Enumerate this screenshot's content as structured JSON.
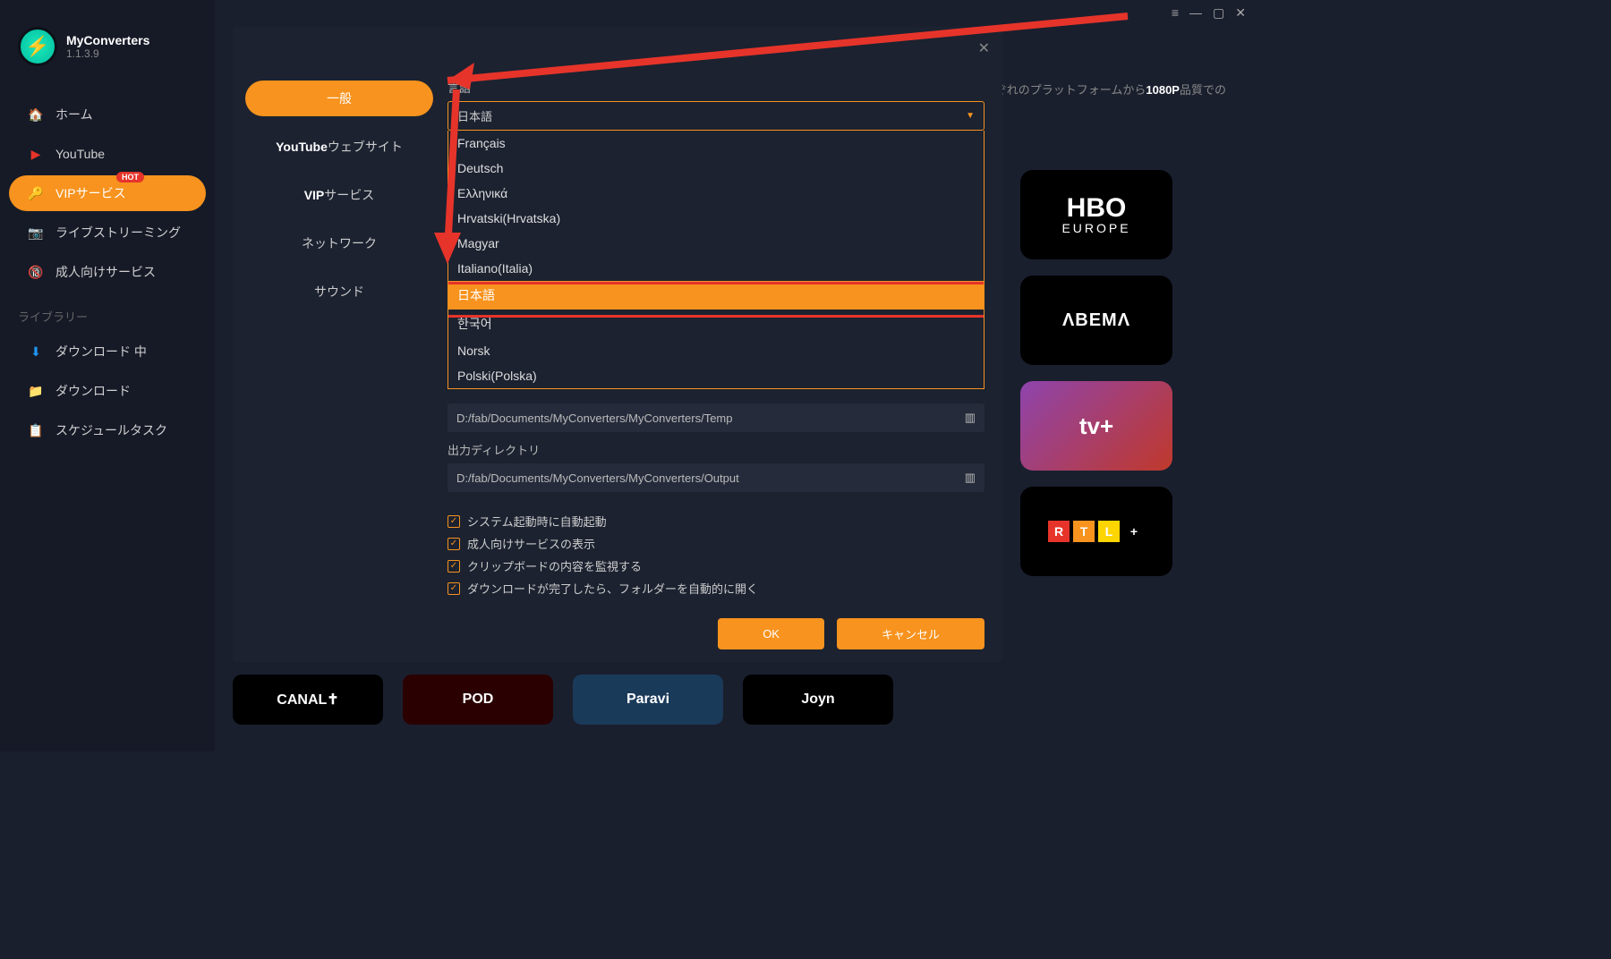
{
  "app": {
    "name": "MyConverters",
    "version": "1.1.3.9"
  },
  "titlebar": {
    "menu": "≡",
    "min": "—",
    "max": "▢",
    "close": "✕"
  },
  "sidebar": {
    "items": [
      {
        "icon": "🏠",
        "label": "ホーム"
      },
      {
        "icon": "▶",
        "label": "YouTube",
        "iconColor": "#e6342a"
      },
      {
        "icon": "🔑",
        "label": "VIPサービス",
        "hot": "HOT"
      },
      {
        "icon": "📷",
        "label": "ライブストリーミング",
        "iconColor": "#e6342a"
      },
      {
        "icon": "🔞",
        "label": "成人向けサービス",
        "iconColor": "#e6342a"
      }
    ],
    "library_label": "ライブラリー",
    "library": [
      {
        "icon": "⬇",
        "label": "ダウンロード 中",
        "iconColor": "#2196f3"
      },
      {
        "icon": "📁",
        "label": "ダウンロード",
        "iconColor": "#f7931e"
      },
      {
        "icon": "📋",
        "label": "スケジュールタスク",
        "iconColor": "#9c27b0"
      }
    ]
  },
  "bg": {
    "text_prefix": "ぞれのプラットフォームから",
    "quality": "1080P",
    "text_suffix": "品質での"
  },
  "tiles": {
    "hbo": "HBO",
    "hbo_sub": "EUROPE",
    "abema": "ΛBEMΛ",
    "appletv": "tv+",
    "rtl": [
      "R",
      "T",
      "L",
      "+"
    ],
    "bottom": [
      "CANAL✝",
      "POD",
      "Paravi",
      "Joyn"
    ]
  },
  "modal": {
    "close": "✕",
    "tabs": [
      "一般",
      "YouTubeウェブサイト",
      "VIPサービス",
      "ネットワーク",
      "サウンド"
    ],
    "tabs_bold_prefix": [
      "",
      "YouTube",
      "VIP",
      "",
      ""
    ],
    "tabs_rest": [
      "一般",
      "ウェブサイト",
      "サービス",
      "ネットワーク",
      "サウンド"
    ],
    "lang_label": "言語",
    "lang_selected": "日本語",
    "lang_options": [
      "Français",
      "Deutsch",
      "Ελληνικά",
      "Hrvatski(Hrvatska)",
      "Magyar",
      "Italiano(Italia)",
      "日本語",
      "한국어",
      "Norsk",
      "Polski(Polska)"
    ],
    "temp_path": "D:/fab/Documents/MyConverters/MyConverters/Temp",
    "output_label": "出力ディレクトリ",
    "output_path": "D:/fab/Documents/MyConverters/MyConverters/Output",
    "checks": [
      "システム起動時に自動起動",
      "成人向けサービスの表示",
      "クリップボードの内容を監視する",
      "ダウンロードが完了したら、フォルダーを自動的に開く"
    ],
    "ok": "OK",
    "cancel": "キャンセル"
  }
}
